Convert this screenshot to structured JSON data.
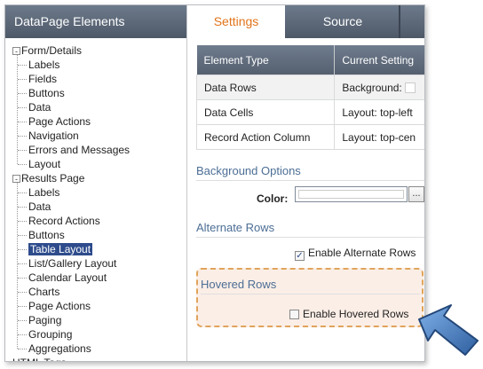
{
  "left_panel": {
    "title": "DataPage Elements",
    "groups": [
      {
        "label": "Form/Details",
        "expander": "-",
        "items": [
          "Labels",
          "Fields",
          "Buttons",
          "Data",
          "Page Actions",
          "Navigation",
          "Errors and Messages",
          "Layout"
        ]
      },
      {
        "label": "Results Page",
        "expander": "-",
        "items": [
          "Labels",
          "Data",
          "Record Actions",
          "Buttons",
          "Table Layout",
          "List/Gallery Layout",
          "Calendar Layout",
          "Charts",
          "Page Actions",
          "Paging",
          "Grouping",
          "Aggregations"
        ]
      },
      {
        "label": "HTML Tags",
        "expander": "",
        "items": []
      }
    ],
    "selected": "Table Layout"
  },
  "tabs": {
    "active": "Settings",
    "other": "Source"
  },
  "grid": {
    "headers": [
      "Element Type",
      "Current Setting"
    ],
    "rows": [
      {
        "type": "Data Rows",
        "setting": "Background:"
      },
      {
        "type": "Data Cells",
        "setting": "Layout: top-left"
      },
      {
        "type": "Record Action Column",
        "setting": "Layout: top-cen"
      }
    ]
  },
  "background_options": {
    "title": "Background Options",
    "color_label": "Color:",
    "browse_label": "..."
  },
  "alternate_rows": {
    "title": "Alternate Rows",
    "checkbox_label": "Enable Alternate Rows",
    "checked": true
  },
  "hovered_rows": {
    "title": "Hovered Rows",
    "checkbox_label": "Enable Hovered Rows",
    "checked": false
  },
  "colors": {
    "header_dark": "#55606f",
    "accent_orange": "#e2741a",
    "section_blue": "#4c6e96",
    "selection": "#2e4c8c",
    "highlight_border": "#e0a45c",
    "arrow_blue": "#3f78c4"
  },
  "icons": {
    "arrow": "callout-arrow-icon",
    "check": "checkmark-icon"
  }
}
